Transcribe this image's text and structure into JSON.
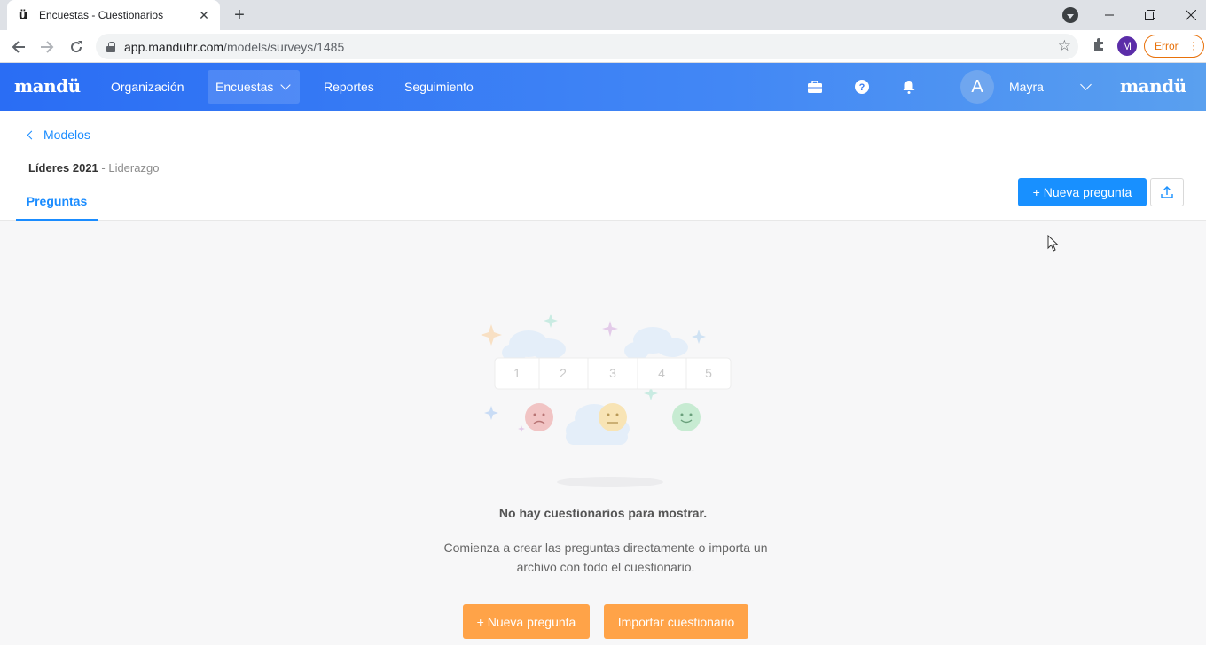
{
  "browser": {
    "tab_title": "Encuestas - Cuestionarios",
    "tab_favicon": "ü",
    "url_host": "app.manduhr.com",
    "url_path": "/models/surveys/1485",
    "profile_initial": "M",
    "error_label": "Error"
  },
  "app": {
    "logo": "mandü",
    "logo_right": "mandü",
    "nav": {
      "organizacion": "Organización",
      "encuestas": "Encuestas",
      "reportes": "Reportes",
      "seguimiento": "Seguimiento"
    },
    "user": {
      "avatar_initial": "A",
      "name": "Mayra"
    },
    "colors": {
      "header_start": "#2a6df4",
      "header_end": "#5aa0ef",
      "primary": "#1890ff",
      "orange": "#ffa348"
    }
  },
  "page": {
    "back_label": "Modelos",
    "model_title": "Líderes 2021",
    "model_sub": " - Liderazgo",
    "tab_label": "Preguntas",
    "new_question_btn": "+ Nueva pregunta"
  },
  "empty_state": {
    "scale": [
      "1",
      "2",
      "3",
      "4",
      "5"
    ],
    "title": "No hay cuestionarios para mostrar.",
    "description": "Comienza a crear las preguntas directamente o importa un archivo con todo el cuestionario.",
    "btn_new": "+ Nueva pregunta",
    "btn_import": "Importar cuestionario"
  }
}
